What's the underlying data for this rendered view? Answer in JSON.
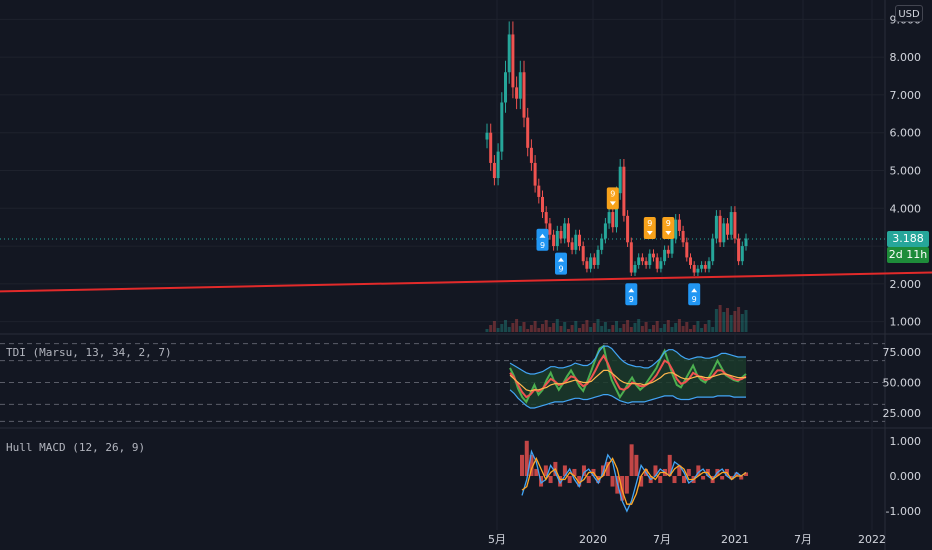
{
  "currency": "USD",
  "last_price": "3.188",
  "countdown": "2d 11h",
  "colors": {
    "up": "#26a69a",
    "down": "#ef5350",
    "trendline": "#e22a2a",
    "last_price_bg": "#26a69a",
    "countdown_bg": "#1e8c3a",
    "sell_marker": "#f7a21b",
    "buy_marker": "#2196f3"
  },
  "chart_data": [
    {
      "type": "candlestick",
      "title": "",
      "ylim": [
        0.7,
        9.3
      ],
      "y_ticks": [
        "9.000",
        "8.000",
        "7.000",
        "6.000",
        "5.000",
        "4.000",
        "3.000",
        "2.000",
        "1.000"
      ],
      "x_ticks": [
        "5月",
        "2020",
        "7月",
        "2021",
        "7月",
        "2022"
      ],
      "close_series": [
        6.0,
        5.2,
        4.8,
        5.5,
        6.8,
        7.6,
        8.6,
        7.2,
        6.9,
        7.6,
        6.4,
        5.6,
        5.2,
        4.6,
        4.3,
        3.9,
        3.6,
        3.3,
        3.0,
        3.4,
        3.2,
        3.6,
        3.1,
        2.9,
        3.3,
        3.0,
        2.6,
        2.4,
        2.7,
        2.5,
        2.9,
        3.2,
        3.6,
        3.9,
        3.5,
        4.4,
        5.1,
        3.8,
        3.1,
        2.3,
        2.5,
        2.7,
        2.6,
        2.5,
        2.8,
        2.7,
        2.4,
        2.6,
        2.9,
        2.8,
        3.2,
        3.7,
        3.4,
        3.1,
        2.7,
        2.5,
        2.3,
        2.4,
        2.5,
        2.4,
        2.6,
        3.2,
        3.8,
        3.1,
        3.6,
        3.3,
        3.9,
        3.2,
        2.6,
        3.0,
        3.2
      ],
      "last_price": 3.188,
      "trendline": {
        "from": 1.8,
        "to": 2.3
      },
      "td_sequential_markers": [
        {
          "label": "9",
          "kind": "sell",
          "index": 6
        },
        {
          "label": "9",
          "kind": "buy",
          "index": 15
        },
        {
          "label": "9",
          "kind": "buy",
          "index": 20
        },
        {
          "label": "9",
          "kind": "sell",
          "index": 34
        },
        {
          "label": "9",
          "kind": "buy",
          "index": 39
        },
        {
          "label": "9",
          "kind": "sell",
          "index": 44
        },
        {
          "label": "9",
          "kind": "sell",
          "index": 49
        },
        {
          "label": "9",
          "kind": "buy",
          "index": 56
        }
      ]
    },
    {
      "type": "line",
      "title": "TDI (Marsu, 13, 34, 2, 7)",
      "ylim": [
        15,
        85
      ],
      "y_ticks": [
        "75.000",
        "50.000",
        "25.000"
      ],
      "reference_lines": [
        82,
        68,
        50,
        32,
        18
      ],
      "series": [
        {
          "color": "#4caf50",
          "values": [
            62,
            55,
            45,
            38,
            34,
            41,
            48,
            40,
            44,
            52,
            58,
            50,
            44,
            49,
            55,
            60,
            54,
            47,
            43,
            51,
            60,
            69,
            78,
            80,
            64,
            52,
            45,
            38,
            43,
            49,
            54,
            48,
            44,
            47,
            52,
            57,
            62,
            70,
            76,
            66,
            56,
            48,
            46,
            52,
            58,
            64,
            56,
            52,
            50,
            55,
            61,
            68,
            62,
            56,
            54,
            52,
            51,
            54,
            57
          ]
        },
        {
          "color": "#ef5350",
          "values": [
            58,
            54,
            48,
            42,
            38,
            40,
            44,
            43,
            45,
            49,
            53,
            51,
            48,
            49,
            52,
            55,
            54,
            50,
            47,
            49,
            54,
            60,
            67,
            72,
            66,
            58,
            51,
            45,
            44,
            46,
            50,
            49,
            47,
            47,
            49,
            52,
            56,
            62,
            68,
            66,
            60,
            53,
            49,
            50,
            53,
            58,
            56,
            54,
            52,
            53,
            56,
            60,
            60,
            57,
            55,
            53,
            52,
            53,
            55
          ]
        },
        {
          "color": "#ffb74d",
          "values": [
            56,
            53,
            50,
            47,
            44,
            43,
            44,
            44,
            45,
            46,
            48,
            49,
            49,
            49,
            50,
            51,
            52,
            51,
            50,
            50,
            51,
            54,
            57,
            60,
            60,
            58,
            55,
            52,
            50,
            49,
            49,
            49,
            49,
            48,
            49,
            50,
            52,
            54,
            57,
            58,
            58,
            56,
            54,
            53,
            53,
            54,
            55,
            55,
            54,
            54,
            55,
            56,
            57,
            57,
            56,
            55,
            54,
            54,
            54
          ]
        },
        {
          "color": "#42a5f5",
          "values": [
            66,
            64,
            62,
            60,
            58,
            57,
            57,
            58,
            59,
            61,
            63,
            63,
            62,
            62,
            63,
            64,
            66,
            65,
            64,
            64,
            66,
            70,
            76,
            80,
            80,
            78,
            74,
            70,
            67,
            65,
            64,
            63,
            63,
            62,
            62,
            64,
            67,
            70,
            75,
            77,
            77,
            75,
            72,
            70,
            69,
            70,
            71,
            71,
            70,
            70,
            71,
            72,
            74,
            74,
            73,
            72,
            71,
            71,
            71
          ]
        },
        {
          "color": "#42a5f5",
          "values": [
            44,
            41,
            37,
            34,
            31,
            29,
            29,
            30,
            31,
            32,
            33,
            34,
            34,
            34,
            35,
            36,
            37,
            37,
            36,
            36,
            37,
            38,
            39,
            40,
            40,
            39,
            37,
            35,
            34,
            33,
            34,
            34,
            34,
            34,
            35,
            36,
            37,
            38,
            39,
            39,
            39,
            37,
            36,
            36,
            36,
            37,
            38,
            38,
            38,
            38,
            38,
            39,
            39,
            39,
            39,
            38,
            38,
            38,
            38
          ]
        }
      ]
    },
    {
      "type": "line",
      "title": "Hull MACD (12, 26, 9)",
      "ylim": [
        -1.25,
        1.25
      ],
      "y_ticks": [
        "1.000",
        "0.000",
        "-1.000"
      ],
      "series": [
        {
          "color": "#42a5f5",
          "values": [
            -0.55,
            -0.1,
            0.7,
            0.4,
            -0.2,
            -0.1,
            0.3,
            0.1,
            -0.2,
            0.0,
            0.2,
            -0.1,
            -0.3,
            0.1,
            0.2,
            0.0,
            -0.2,
            0.1,
            0.6,
            0.4,
            -0.2,
            -0.7,
            -1.0,
            -0.7,
            -0.2,
            0.3,
            0.1,
            -0.1,
            0.0,
            0.2,
            0.1,
            0.0,
            0.4,
            0.3,
            0.1,
            -0.2,
            -0.1,
            0.1,
            0.2,
            0.0,
            -0.1,
            0.1,
            0.2,
            0.0,
            -0.1,
            0.1,
            0.0,
            0.1
          ]
        },
        {
          "color": "#ffa726",
          "values": [
            -0.4,
            -0.3,
            0.2,
            0.5,
            0.2,
            -0.1,
            0.1,
            0.2,
            -0.1,
            -0.1,
            0.1,
            0.0,
            -0.2,
            -0.1,
            0.1,
            0.1,
            -0.1,
            0.0,
            0.3,
            0.5,
            0.2,
            -0.4,
            -0.8,
            -0.8,
            -0.5,
            0.0,
            0.2,
            0.0,
            -0.1,
            0.1,
            0.1,
            0.0,
            0.2,
            0.3,
            0.2,
            -0.1,
            -0.1,
            0.0,
            0.1,
            0.1,
            -0.1,
            0.0,
            0.1,
            0.1,
            -0.1,
            0.0,
            0.0,
            0.1
          ]
        },
        {
          "color": "#ef5350",
          "values": [
            0.6,
            1.0,
            0.6,
            0.2,
            -0.3,
            0.3,
            -0.2,
            0.4,
            -0.3,
            0.3,
            -0.2,
            0.2,
            -0.3,
            0.3,
            -0.2,
            0.2,
            -0.2,
            0.3,
            0.4,
            -0.3,
            -0.5,
            -0.7,
            -0.5,
            0.9,
            0.6,
            -0.3,
            0.2,
            -0.2,
            0.3,
            -0.2,
            0.2,
            0.6,
            -0.2,
            0.3,
            -0.2,
            0.2,
            -0.2,
            0.3,
            -0.1,
            0.2,
            -0.2,
            0.2,
            -0.1,
            0.2,
            -0.1,
            0.1,
            -0.1,
            0.1
          ]
        }
      ]
    }
  ]
}
